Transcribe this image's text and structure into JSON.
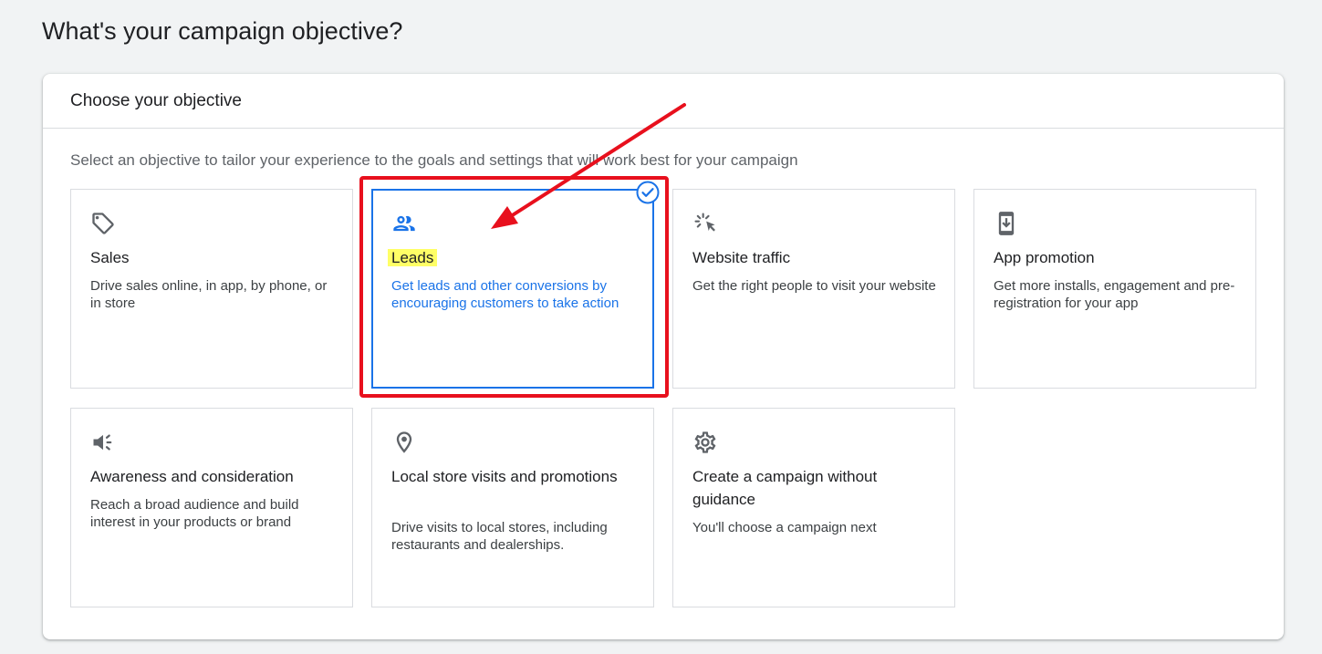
{
  "page": {
    "title": "What's your campaign objective?"
  },
  "panel": {
    "title": "Choose your objective",
    "subtitle": "Select an objective to tailor your experience to the goals and settings that will work best for your campaign"
  },
  "objectives": [
    {
      "icon": "tag-icon",
      "title": "Sales",
      "description": "Drive sales online, in app, by phone, or in store",
      "selected": false
    },
    {
      "icon": "people-icon",
      "title": "Leads",
      "description": "Get leads and other conversions by encouraging customers to take action",
      "selected": true
    },
    {
      "icon": "cursor-click-icon",
      "title": "Website traffic",
      "description": "Get the right people to visit your website",
      "selected": false
    },
    {
      "icon": "phone-download-icon",
      "title": "App promotion",
      "description": "Get more installs, engagement and pre-registration for your app",
      "selected": false
    },
    {
      "icon": "megaphone-icon",
      "title": "Awareness and consideration",
      "description": "Reach a broad audience and build interest in your products or brand",
      "selected": false
    },
    {
      "icon": "location-pin-icon",
      "title": "Local store visits and promotions",
      "description": "Drive visits to local stores, including restaurants and dealerships.",
      "selected": false
    },
    {
      "icon": "gear-icon",
      "title": "Create a campaign without guidance",
      "description": "You'll choose a campaign next",
      "selected": false
    }
  ],
  "colors": {
    "accent": "#1a73e8",
    "annotation_red": "#e8101d",
    "highlight_yellow": "#ffff66",
    "background": "#f1f3f4"
  }
}
